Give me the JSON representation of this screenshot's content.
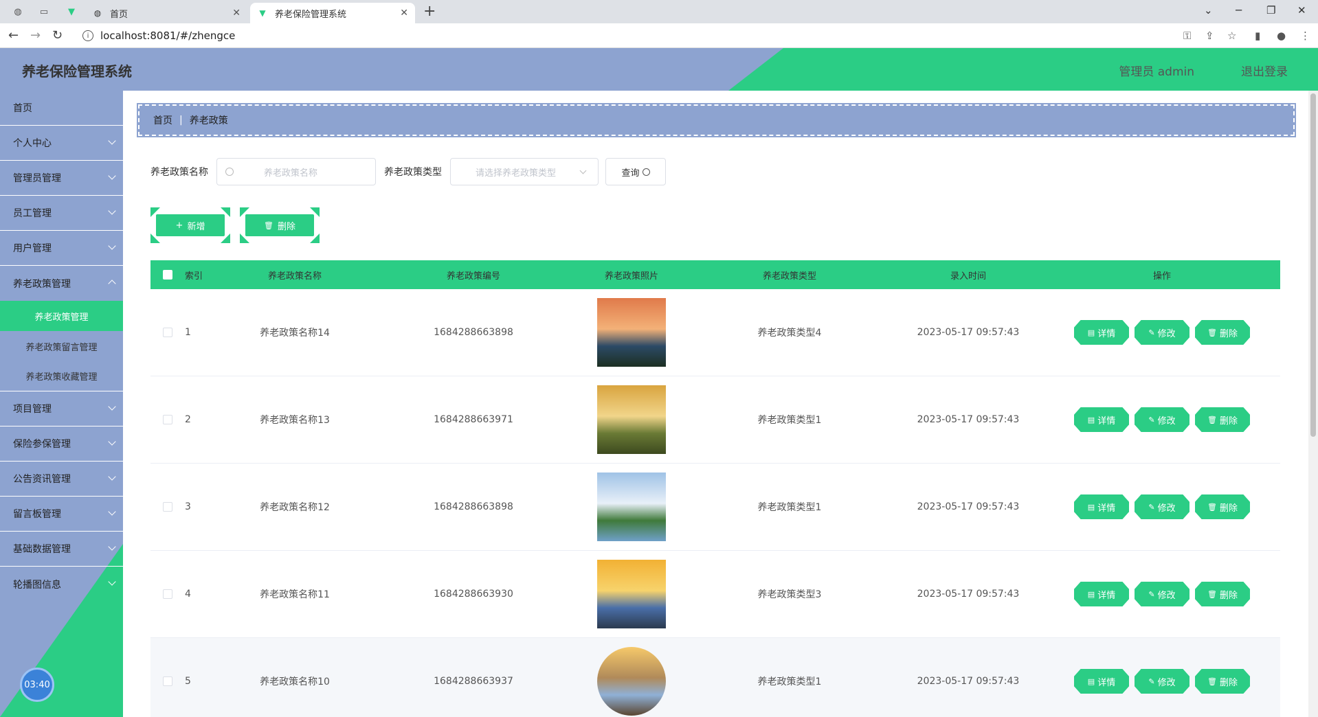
{
  "browser": {
    "tabs": [
      {
        "label": "首页"
      },
      {
        "label": "养老保险管理系统"
      }
    ],
    "url": "localhost:8081/#/zhengce"
  },
  "app": {
    "title": "养老保险管理系统",
    "user": "管理员 admin",
    "logout": "退出登录"
  },
  "sidebar": {
    "items": [
      {
        "label": "首页"
      },
      {
        "label": "个人中心"
      },
      {
        "label": "管理员管理"
      },
      {
        "label": "员工管理"
      },
      {
        "label": "用户管理"
      },
      {
        "label": "养老政策管理"
      }
    ],
    "sub_items": [
      {
        "label": "养老政策管理"
      },
      {
        "label": "养老政策留言管理"
      },
      {
        "label": "养老政策收藏管理"
      }
    ],
    "items_after": [
      {
        "label": "项目管理"
      },
      {
        "label": "保险参保管理"
      },
      {
        "label": "公告资讯管理"
      },
      {
        "label": "留言板管理"
      },
      {
        "label": "基础数据管理"
      },
      {
        "label": "轮播图信息"
      }
    ],
    "clock": "03:40"
  },
  "breadcrumb": {
    "home": "首页",
    "current": "养老政策"
  },
  "search": {
    "name_label": "养老政策名称",
    "name_placeholder": "养老政策名称",
    "type_label": "养老政策类型",
    "type_placeholder": "请选择养老政策类型",
    "query_label": "查询"
  },
  "actions": {
    "add": "新增",
    "delete": "删除"
  },
  "table": {
    "headers": [
      "索引",
      "养老政策名称",
      "养老政策编号",
      "养老政策照片",
      "养老政策类型",
      "录入时间",
      "操作"
    ],
    "op_labels": {
      "detail": "详情",
      "edit": "修改",
      "delete": "删除"
    },
    "rows": [
      {
        "index": "1",
        "name": "养老政策名称14",
        "no": "1684288663898",
        "type": "养老政策类型4",
        "time": "2023-05-17 09:57:43"
      },
      {
        "index": "2",
        "name": "养老政策名称13",
        "no": "1684288663971",
        "type": "养老政策类型1",
        "time": "2023-05-17 09:57:43"
      },
      {
        "index": "3",
        "name": "养老政策名称12",
        "no": "1684288663898",
        "type": "养老政策类型1",
        "time": "2023-05-17 09:57:43"
      },
      {
        "index": "4",
        "name": "养老政策名称11",
        "no": "1684288663930",
        "type": "养老政策类型3",
        "time": "2023-05-17 09:57:43"
      },
      {
        "index": "5",
        "name": "养老政策名称10",
        "no": "1684288663937",
        "type": "养老政策类型1",
        "time": "2023-05-17 09:57:43"
      }
    ]
  },
  "colors": {
    "accent": "#2bcd85",
    "sidebar": "#8da3d0"
  }
}
